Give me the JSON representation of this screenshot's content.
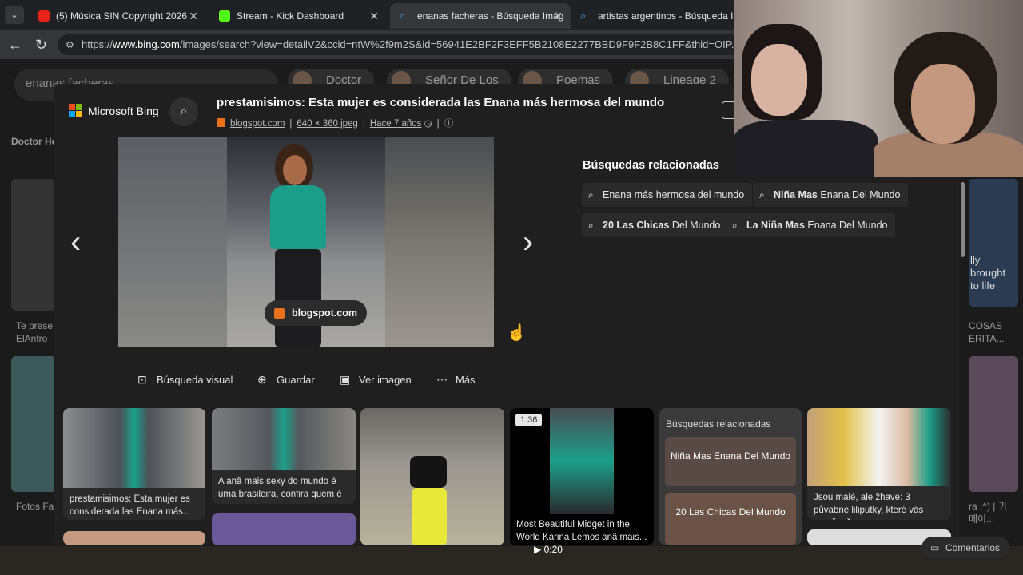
{
  "browser": {
    "tabs": [
      {
        "title": "(5) Música SIN Copyright 2026",
        "active": false,
        "favicon_color": "#ff0000"
      },
      {
        "title": "Stream - Kick Dashboard",
        "active": false,
        "favicon_color": "#53fc18"
      },
      {
        "title": "enanas facheras - Búsqueda Imág",
        "active": true,
        "favicon_color": "#4aa3ff"
      },
      {
        "title": "artistas argentinos - Búsqueda Ima",
        "active": false,
        "favicon_color": "#4aa3ff"
      }
    ],
    "url_prefix": "https://",
    "url_host": "www.bing.com",
    "url_path": "/images/search?view=detailV2&ccid=ntW%2f9m2S&id=56941E2BF2F3EFF5B2108E2277BBD9F9F2B8C1FF&thid=OIP.n"
  },
  "background": {
    "search_text": "enanas facheras",
    "chips": [
      "Doctor",
      "Señor De Los",
      "Poemas",
      "Lineage 2"
    ],
    "left_caption_1": "Doctor Ho",
    "left_caption_2": "Te prese ElAntro",
    "left_caption_3": "Fotos Fa",
    "right_caption_1": "COSAS ERITA...",
    "right_caption_2": "ra :^) | 귀 메이...",
    "right_overlay": "lly brought to life",
    "video_time": "0:20",
    "comments_label": "Comentarios"
  },
  "modal": {
    "logo_text": "Microsoft Bing",
    "title": "prestamisimos: Esta mujer es considerada las Enana más hermosa del mundo",
    "source": "blogspot.com",
    "dimensions": "640 × 360 jpeg",
    "age": "Hace 7 años",
    "image_source_pill": "blogspot.com",
    "related_heading": "Búsquedas relacionadas",
    "related": [
      {
        "bold": "",
        "rest": "Enana más hermosa del mundo"
      },
      {
        "bold": "Niña Mas",
        "rest": " Enana Del Mundo"
      },
      {
        "bold": "20 Las Chicas",
        "rest": " Del Mundo"
      },
      {
        "bold": "La Niña Mas",
        "rest": " Enana Del Mundo"
      }
    ],
    "actions": [
      "Búsqueda visual",
      "Guardar",
      "Ver imagen",
      "Más"
    ]
  },
  "grid": {
    "card1_caption": "prestamisimos: Esta mujer es considerada las Enana más...",
    "card2_caption": "A anã mais sexy do mundo é uma brasileira, confira quem é",
    "card4_badge": "1:36",
    "card4_caption": "Most Beautiful Midget in the World Karina Lemos anã mais...",
    "related_panel_heading": "Búsquedas relacionadas",
    "related_panel_items": [
      "Niña Mas Enana Del Mundo",
      "20 Las Chicas Del Mundo"
    ],
    "card6_caption": "Jsou malé, ale žhavé: 3 půvabné liliputky, které vás zaručeně..."
  }
}
